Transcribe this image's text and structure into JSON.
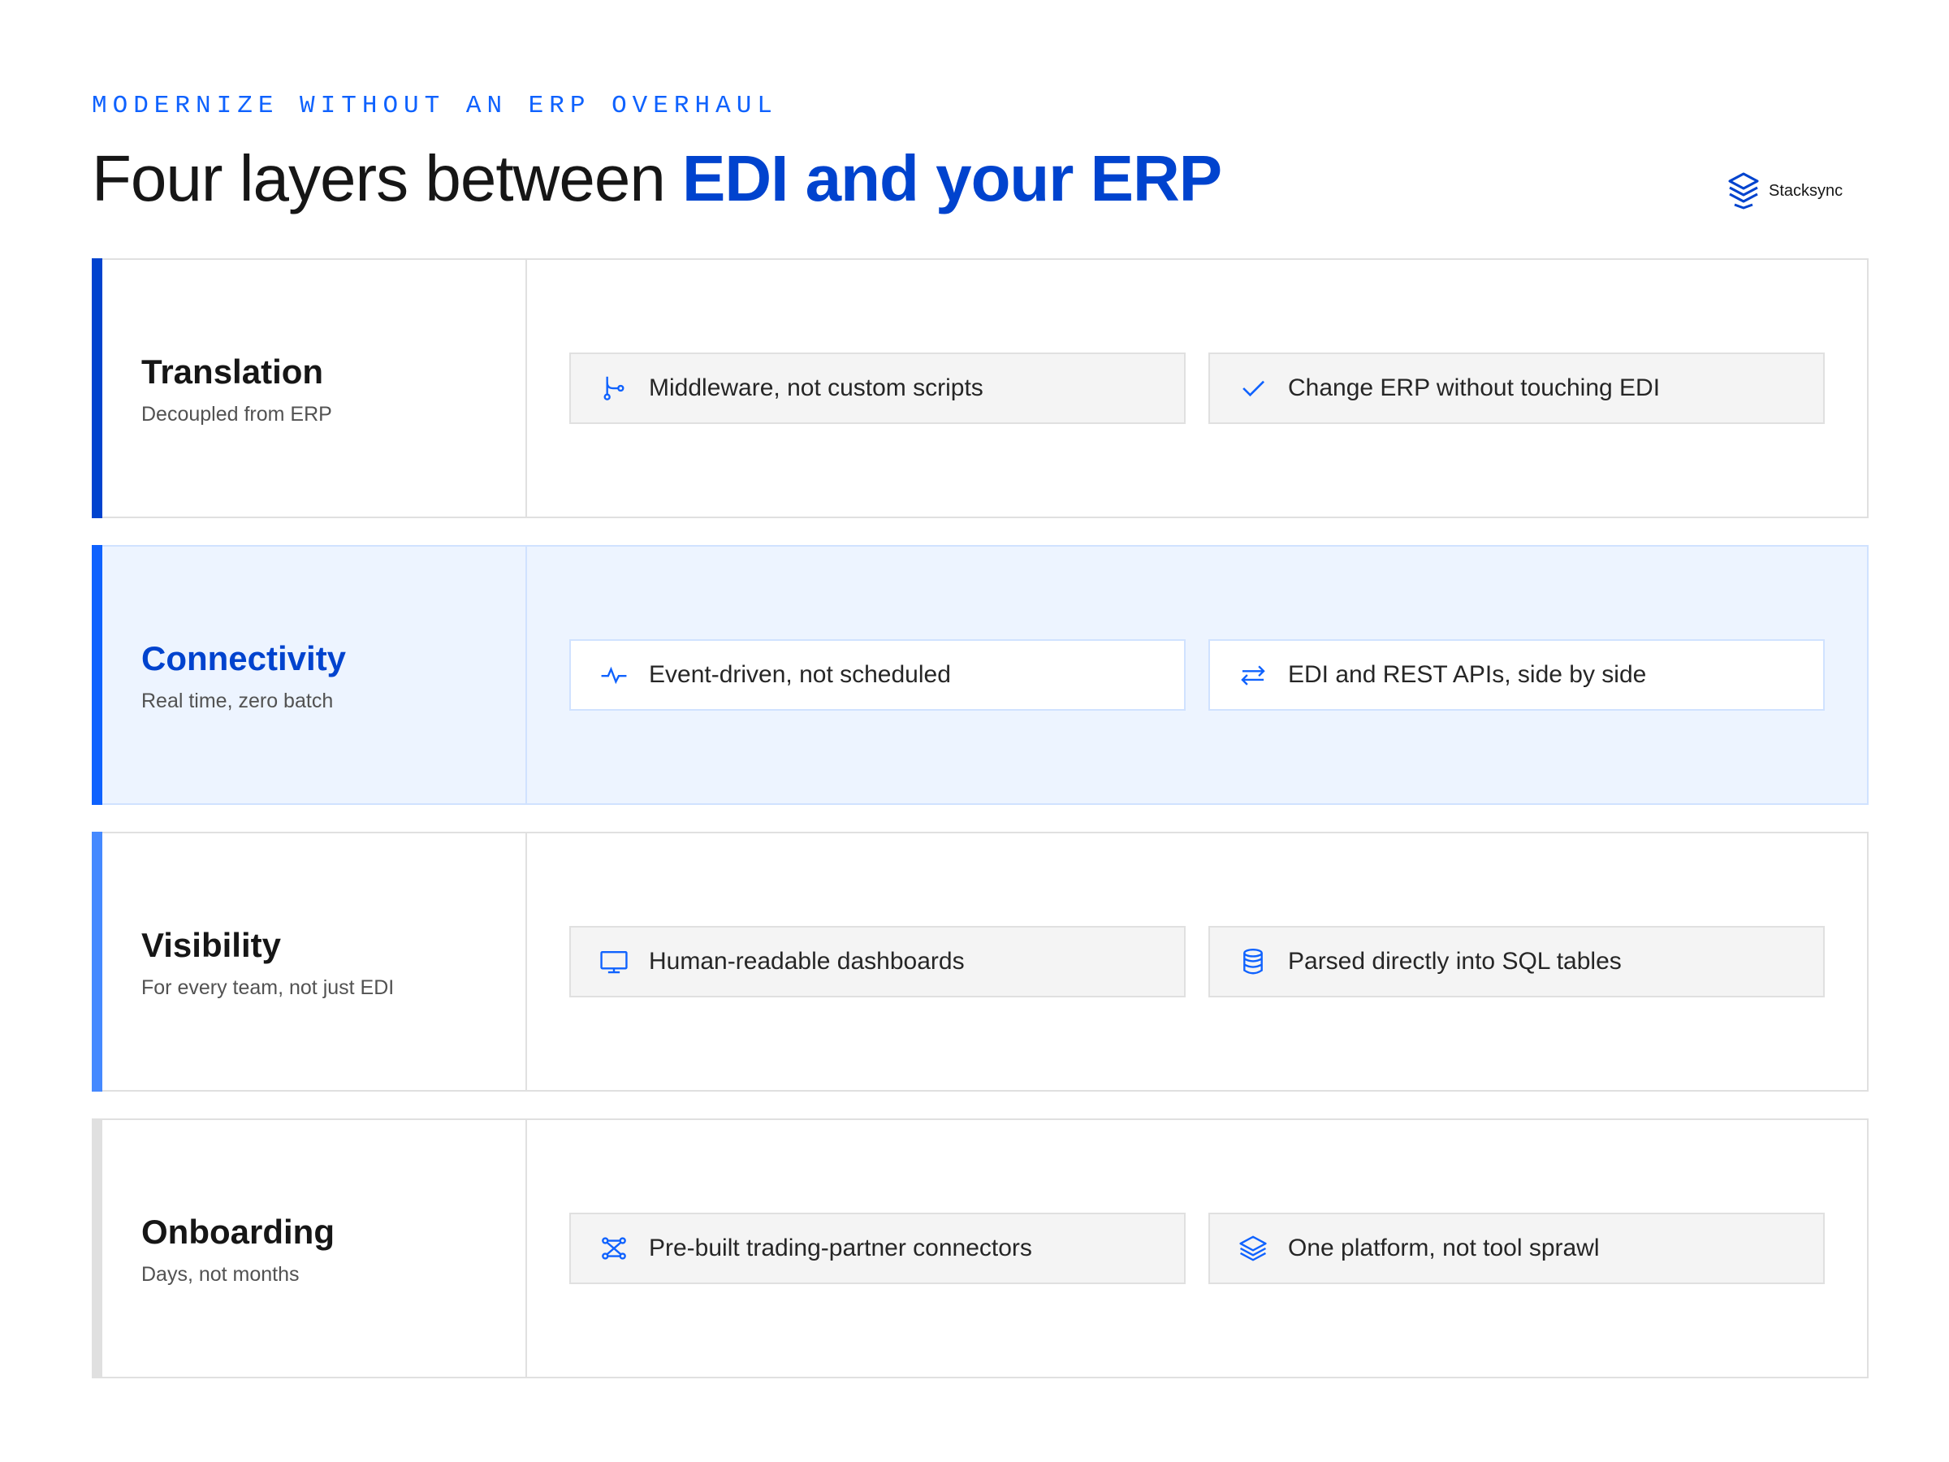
{
  "header": {
    "eyebrow": "MODERNIZE WITHOUT AN ERP OVERHAUL",
    "title_plain": "Four layers between ",
    "title_accent": "EDI and your ERP"
  },
  "logo": {
    "text": "Stacksync",
    "icon": "stacksync-logo"
  },
  "colors": {
    "accent": "#0f62fe",
    "accent_dark": "#0043ce",
    "active_bg": "#edf4ff",
    "card_bg": "#f4f4f4",
    "border": "#e0e0e0"
  },
  "layers": [
    {
      "name": "Translation",
      "subtitle": "Decoupled from ERP",
      "bar_color": "#0043ce",
      "active": false,
      "features": [
        {
          "label": "Middleware, not custom scripts",
          "icon": "branch-icon"
        },
        {
          "label": "Change ERP without touching EDI",
          "icon": "checkmark-icon"
        }
      ]
    },
    {
      "name": "Connectivity",
      "subtitle": "Real time, zero batch",
      "bar_color": "#0f62fe",
      "active": true,
      "features": [
        {
          "label": "Event-driven, not scheduled",
          "icon": "pulse-icon"
        },
        {
          "label": "EDI and REST APIs, side by side",
          "icon": "arrows-exchange-icon"
        }
      ]
    },
    {
      "name": "Visibility",
      "subtitle": "For every team, not just EDI",
      "bar_color": "#4589ff",
      "active": false,
      "features": [
        {
          "label": "Human-readable dashboards",
          "icon": "monitor-icon"
        },
        {
          "label": "Parsed directly into SQL tables",
          "icon": "database-icon"
        }
      ]
    },
    {
      "name": "Onboarding",
      "subtitle": "Days, not months",
      "bar_color": "#e0e0e0",
      "active": false,
      "features": [
        {
          "label": "Pre-built trading-partner connectors",
          "icon": "connectors-icon"
        },
        {
          "label": "One platform, not tool sprawl",
          "icon": "layers-icon"
        }
      ]
    }
  ]
}
